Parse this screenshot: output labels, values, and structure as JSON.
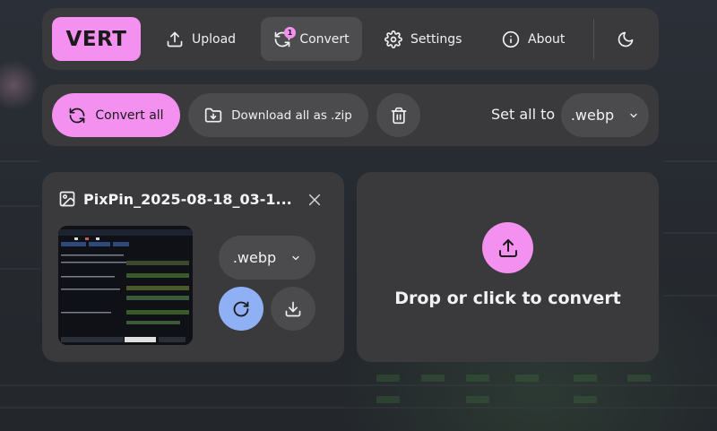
{
  "nav": {
    "logo": "VERT",
    "upload": "Upload",
    "convert": "Convert",
    "convert_badge": "1",
    "settings": "Settings",
    "about": "About"
  },
  "toolbar": {
    "convert_all": "Convert all",
    "download_zip": "Download all as .zip",
    "set_all_label": "Set all to",
    "set_all_value": ".webp"
  },
  "file": {
    "name": "PixPin_2025-08-18_03-1...",
    "format": ".webp"
  },
  "dropzone": {
    "text": "Drop or click to convert"
  },
  "colors": {
    "accent": "#f390f0",
    "convert_blue": "#8fb0f4",
    "panel": "#3a3a3c"
  }
}
